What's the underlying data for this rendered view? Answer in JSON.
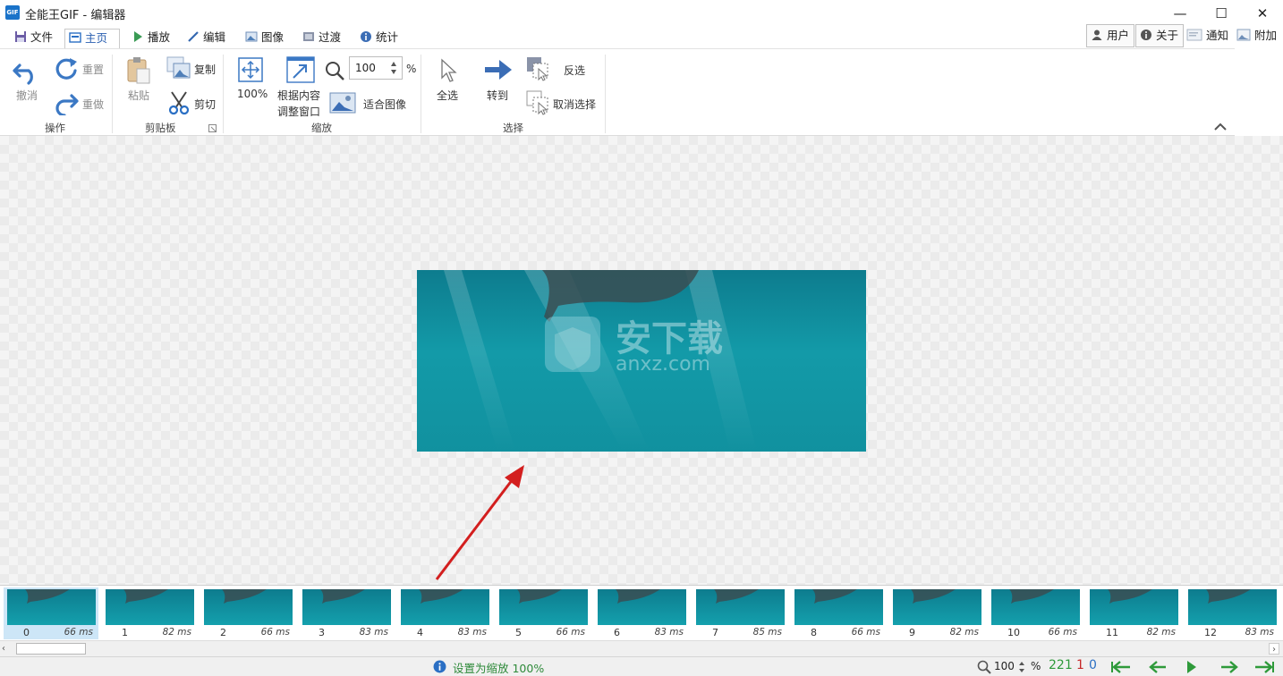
{
  "window": {
    "title": "全能王GIF - 编辑器",
    "app_icon_text": "GIF",
    "minimize_glyph": "—",
    "maximize_glyph": "☐",
    "close_glyph": "✕"
  },
  "tabs": [
    {
      "label": "文件",
      "icon": "save-icon"
    },
    {
      "label": "主页",
      "icon": "home-icon",
      "active": true
    },
    {
      "label": "播放",
      "icon": "play-icon"
    },
    {
      "label": "编辑",
      "icon": "pencil-icon"
    },
    {
      "label": "图像",
      "icon": "image-icon"
    },
    {
      "label": "过渡",
      "icon": "transition-icon"
    },
    {
      "label": "统计",
      "icon": "info-icon"
    }
  ],
  "right_buttons": {
    "user": "用户",
    "about": "关于",
    "notify": "通知",
    "addon": "附加"
  },
  "ribbon": {
    "groups": {
      "actions": "操作",
      "clipboard": "剪贴板",
      "zoom": "缩放",
      "select": "选择"
    },
    "undo": "撤消",
    "reset": "重置",
    "redo": "重做",
    "paste": "粘贴",
    "copy": "复制",
    "cut": "剪切",
    "zoom100": "100%",
    "fit_content_line1": "根据内容",
    "fit_content_line2": "调整窗口",
    "zoom_value": "100",
    "zoom_unit": "%",
    "fit_image": "适合图像",
    "select_all": "全选",
    "goto": "转到",
    "invert": "反选",
    "deselect": "取消选择"
  },
  "frames": [
    {
      "index": "0",
      "delay": "66 ms",
      "selected": true
    },
    {
      "index": "1",
      "delay": "82 ms"
    },
    {
      "index": "2",
      "delay": "66 ms"
    },
    {
      "index": "3",
      "delay": "83 ms"
    },
    {
      "index": "4",
      "delay": "83 ms"
    },
    {
      "index": "5",
      "delay": "66 ms"
    },
    {
      "index": "6",
      "delay": "83 ms"
    },
    {
      "index": "7",
      "delay": "85 ms"
    },
    {
      "index": "8",
      "delay": "66 ms"
    },
    {
      "index": "9",
      "delay": "82 ms"
    },
    {
      "index": "10",
      "delay": "66 ms"
    },
    {
      "index": "11",
      "delay": "82 ms"
    },
    {
      "index": "12",
      "delay": "83 ms"
    }
  ],
  "statusbar": {
    "message": "设置为缩放 100%",
    "zoom_value": "100",
    "zoom_unit": "%",
    "frame_count": "221",
    "selected_count": "1",
    "third_count": "0"
  },
  "colors": {
    "accent": "#2a6fc4",
    "green": "#2e9a3a",
    "red": "#c62828",
    "arrow_red": "#d31f1f",
    "image_teal": "#129aa8"
  }
}
